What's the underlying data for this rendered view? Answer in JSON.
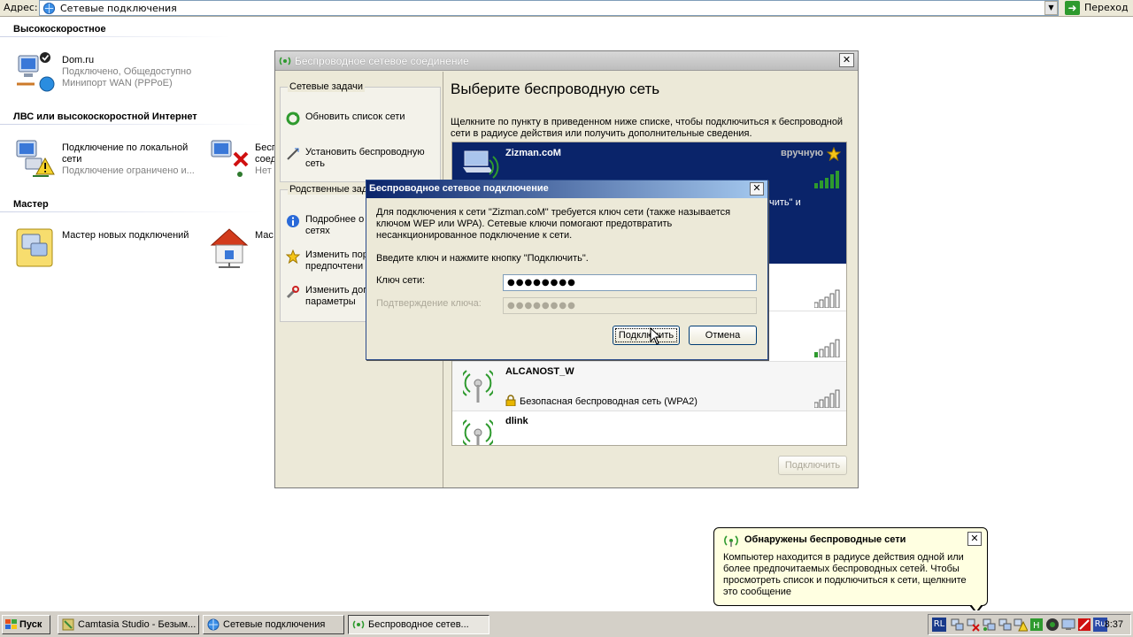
{
  "address_bar": {
    "label": "Адрес:",
    "value": "Сетевые подключения",
    "go_label": "Переход"
  },
  "groups": [
    {
      "title": "Высокоскоростное",
      "items": [
        {
          "name": "Dom.ru",
          "line1": "Подключено, Общедоступно",
          "line2": "Минипорт WAN (PPPoE)"
        }
      ]
    },
    {
      "title": "ЛВС или высокоскоростной Интернет",
      "items": [
        {
          "name": "Подключение по локальной",
          "name2": "сети",
          "line1": "Подключение ограничено и...",
          "icon": "lan-warning-icon"
        },
        {
          "name": "Бесп",
          "name2": "соед",
          "line1": "Нет",
          "icon": "wireless-disconnected-icon"
        }
      ]
    },
    {
      "title": "Мастер",
      "items": [
        {
          "name": "Мастер новых подключений",
          "icon": "new-connection-wizard-icon"
        },
        {
          "name": "Мас",
          "icon": "home-network-wizard-icon"
        }
      ]
    }
  ],
  "wifi_window": {
    "title": "Беспроводное сетевое соединение",
    "network_tasks_header": "Сетевые задачи",
    "network_tasks": [
      {
        "label": "Обновить список сети",
        "icon": "refresh-icon"
      },
      {
        "label": "Установить беспроводную сеть",
        "icon": "wizard-icon"
      }
    ],
    "related_tasks_header": "Родственные зад",
    "related_tasks": [
      {
        "label": "Подробнее о сетях",
        "label1": "Подробнее о",
        "label2": "сетях",
        "icon": "info-icon"
      },
      {
        "label1": "Изменить пор",
        "label2": "предпочтени",
        "icon": "star-icon"
      },
      {
        "label1": "Изменить доп",
        "label2": "параметры",
        "icon": "settings-icon"
      }
    ],
    "heading": "Выберите беспроводную сеть",
    "description": "Щелкните по пункту в приведенном ниже списке, чтобы подключиться к беспроводной сети в радиусе действия или получить дополнительные сведения.",
    "networks": [
      {
        "name": "Zizman.coM",
        "status": "вручную",
        "selected_text": "ючить\" и",
        "signal": 5
      },
      {
        "name": "",
        "signal": 5
      },
      {
        "name": "",
        "signal": 1
      },
      {
        "name": "ALCANOST_W",
        "security": "Безопасная беспроводная сеть (WPA2)",
        "signal": 5
      },
      {
        "name": "dlink",
        "signal": 1
      }
    ],
    "connect_button": "Подключить"
  },
  "dialog": {
    "title": "Беспроводное сетевое подключение",
    "message": "Для подключения к сети \"Zizman.coM\" требуется ключ сети (также называется ключом WEP или WPA). Сетевые ключи помогают предотвратить несанкционированное подключение к сети.",
    "message_lines": [
      "Для подключения к сети \"Zizman.coM\" требуется ключ сети (также называется",
      "ключом WEP или WPA). Сетевые ключи помогают предотвратить",
      "несанкционированное подключение к сети."
    ],
    "instruction": "Введите ключ и нажмите кнопку \"Подключить\".",
    "key_label": "Ключ сети:",
    "key_value": "●●●●●●●●",
    "confirm_label": "Подтверждение ключа:",
    "confirm_value": "●●●●●●●●",
    "connect_label": "Подключить",
    "cancel_label": "Отмена"
  },
  "balloon": {
    "title": "Обнаружены беспроводные сети",
    "body": "Компьютер находится в радиусе действия одной или более предпочитаемых беспроводных сетей. Чтобы просмотреть список и подключиться к сети, щелкните это сообщение"
  },
  "taskbar": {
    "start_label": "Пуск",
    "buttons": [
      {
        "label": "Camtasia Studio - Безым...",
        "icon": "camtasia-icon"
      },
      {
        "label": "Сетевые подключения",
        "icon": "network-connections-icon"
      },
      {
        "label": "Беспроводное сетев...",
        "icon": "wireless-icon",
        "active": true
      }
    ],
    "lang_left": "RL",
    "lang_right": "Ru",
    "clock": "8:37"
  }
}
